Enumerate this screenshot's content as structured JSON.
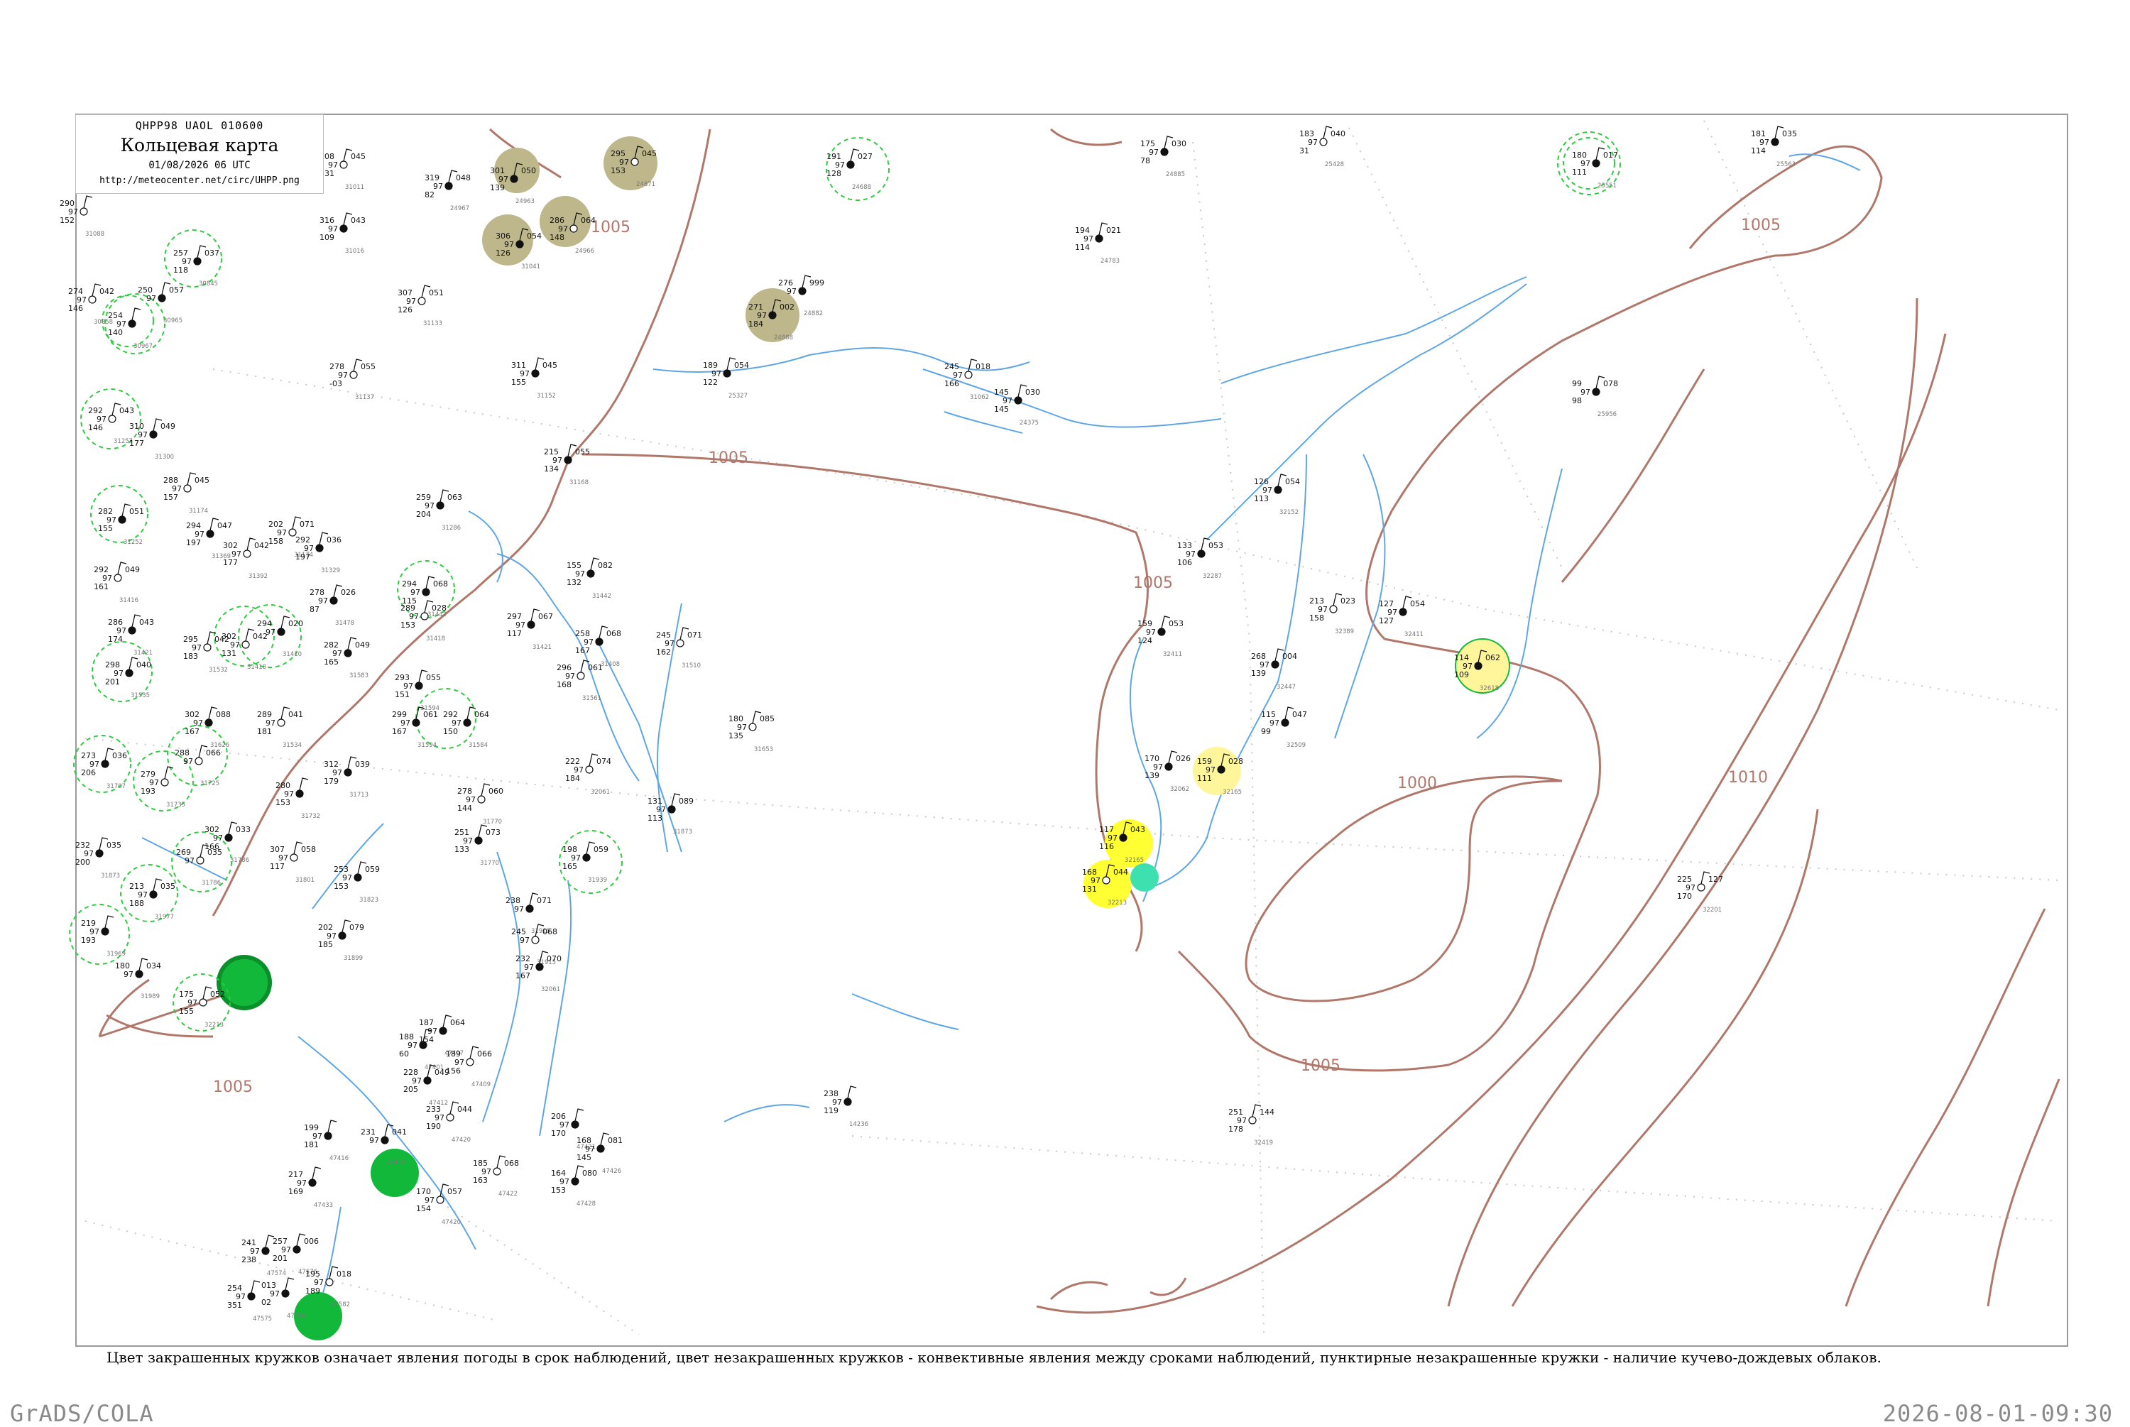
{
  "header": {
    "code": "QHPP98  UAOL  010600",
    "title": "Кольцевая карта",
    "datetime": "01/08/2026 06 UTC",
    "url": "http://meteocenter.net/circ/UHPP.png"
  },
  "isobars": [
    {
      "label": "1005"
    },
    {
      "label": "1005"
    },
    {
      "label": "1005"
    },
    {
      "label": "1005"
    },
    {
      "label": "1005"
    },
    {
      "label": "1005"
    },
    {
      "label": "1000"
    },
    {
      "label": "1010"
    }
  ],
  "stations": [
    {
      "t": "308",
      "dp": "131",
      "p": "045",
      "id": "31011"
    },
    {
      "t": "319",
      "dp": "82",
      "p": "048",
      "id": "24967"
    },
    {
      "t": "301",
      "dp": "139",
      "p": "050",
      "id": "24963"
    },
    {
      "t": "295",
      "dp": "153",
      "p": "045",
      "id": "24871"
    },
    {
      "t": "191",
      "dp": "128",
      "p": "027",
      "id": "24688"
    },
    {
      "t": "175",
      "dp": "78",
      "p": "030",
      "id": "24885"
    },
    {
      "t": "183",
      "dp": "31",
      "p": "040",
      "id": "25428"
    },
    {
      "t": "180",
      "dp": "111",
      "p": "017",
      "id": "25551"
    },
    {
      "t": "181",
      "dp": "114",
      "p": "035",
      "id": "25563"
    },
    {
      "t": "290",
      "dp": "152",
      "p": "",
      "id": "31088"
    },
    {
      "t": "316",
      "dp": "109",
      "p": "043",
      "id": "31016"
    },
    {
      "t": "306",
      "dp": "126",
      "p": "054",
      "id": "31041"
    },
    {
      "t": "286",
      "dp": "148",
      "p": "064",
      "id": "24966"
    },
    {
      "t": "194",
      "dp": "114",
      "p": "021",
      "id": "24783"
    },
    {
      "t": "257",
      "dp": "118",
      "p": "037",
      "id": "30845"
    },
    {
      "t": "274",
      "dp": "146",
      "p": "042",
      "id": "30858"
    },
    {
      "t": "250",
      "dp": "",
      "p": "057",
      "id": "30965"
    },
    {
      "t": "254",
      "dp": "140",
      "p": "",
      "id": "30967"
    },
    {
      "t": "307",
      "dp": "126",
      "p": "051",
      "id": "31133"
    },
    {
      "t": "276",
      "dp": "",
      "p": "999",
      "id": "24882"
    },
    {
      "t": "271",
      "dp": "184",
      "p": "002",
      "id": "24888"
    },
    {
      "t": "278",
      "dp": "-03",
      "p": "055",
      "id": "31137"
    },
    {
      "t": "311",
      "dp": "155",
      "p": "045",
      "id": "31152"
    },
    {
      "t": "189",
      "dp": "122",
      "p": "054",
      "id": "25327"
    },
    {
      "t": "245",
      "dp": "166",
      "p": "018",
      "id": "31062"
    },
    {
      "t": "145",
      "dp": "145",
      "p": "030",
      "id": "24375"
    },
    {
      "t": "99",
      "dp": "98",
      "p": "078",
      "id": "25956"
    },
    {
      "t": "292",
      "dp": "146",
      "p": "043",
      "id": "31257"
    },
    {
      "t": "310",
      "dp": "177",
      "p": "049",
      "id": "31300"
    },
    {
      "t": "215",
      "dp": "134",
      "p": "055",
      "id": "31168"
    },
    {
      "t": "288",
      "dp": "157",
      "p": "045",
      "id": "31174"
    },
    {
      "t": "282",
      "dp": "155",
      "p": "051",
      "id": "31252"
    },
    {
      "t": "259",
      "dp": "204",
      "p": "063",
      "id": "31286"
    },
    {
      "t": "202",
      "dp": "158",
      "p": "071",
      "id": "31174"
    },
    {
      "t": "126",
      "dp": "113",
      "p": "054",
      "id": "32152"
    },
    {
      "t": "294",
      "dp": "197",
      "p": "047",
      "id": "31369"
    },
    {
      "t": "302",
      "dp": "177",
      "p": "042",
      "id": "31392"
    },
    {
      "t": "292",
      "dp": "197",
      "p": "036",
      "id": "31329"
    },
    {
      "t": "133",
      "dp": "106",
      "p": "053",
      "id": "32287"
    },
    {
      "t": "292",
      "dp": "161",
      "p": "049",
      "id": "31416"
    },
    {
      "t": "294",
      "dp": "115",
      "p": "068",
      "id": "31442"
    },
    {
      "t": "155",
      "dp": "132",
      "p": "082",
      "id": "31442"
    },
    {
      "t": "213",
      "dp": "158",
      "p": "023",
      "id": "32389"
    },
    {
      "t": "127",
      "dp": "127",
      "p": "054",
      "id": "32411"
    },
    {
      "t": "286",
      "dp": "174",
      "p": "043",
      "id": "31421"
    },
    {
      "t": "302",
      "dp": "131",
      "p": "042",
      "id": "31418"
    },
    {
      "t": "294",
      "dp": "",
      "p": "020",
      "id": "31410"
    },
    {
      "t": "278",
      "dp": "87",
      "p": "026",
      "id": "31478"
    },
    {
      "t": "289",
      "dp": "153",
      "p": "028",
      "id": "31418"
    },
    {
      "t": "297",
      "dp": "117",
      "p": "067",
      "id": "31421"
    },
    {
      "t": "258",
      "dp": "167",
      "p": "068",
      "id": "31408"
    },
    {
      "t": "245",
      "dp": "162",
      "p": "071",
      "id": "31510"
    },
    {
      "t": "159",
      "dp": "124",
      "p": "053",
      "id": "32411"
    },
    {
      "t": "298",
      "dp": "201",
      "p": "040",
      "id": "31535"
    },
    {
      "t": "295",
      "dp": "183",
      "p": "042",
      "id": "31532"
    },
    {
      "t": "282",
      "dp": "165",
      "p": "049",
      "id": "31583"
    },
    {
      "t": "293",
      "dp": "151",
      "p": "055",
      "id": "31594"
    },
    {
      "t": "296",
      "dp": "168",
      "p": "061",
      "id": "31561"
    },
    {
      "t": "268",
      "dp": "139",
      "p": "004",
      "id": "32447"
    },
    {
      "t": "114",
      "dp": "109",
      "p": "062",
      "id": "32618"
    },
    {
      "t": "289",
      "dp": "181",
      "p": "041",
      "id": "31534"
    },
    {
      "t": "299",
      "dp": "167",
      "p": "061",
      "id": "31594"
    },
    {
      "t": "292",
      "dp": "150",
      "p": "064",
      "id": "31584"
    },
    {
      "t": "180",
      "dp": "135",
      "p": "085",
      "id": "31653"
    },
    {
      "t": "115",
      "dp": "99",
      "p": "047",
      "id": "32509"
    },
    {
      "t": "273",
      "dp": "206",
      "p": "036",
      "id": "31707"
    },
    {
      "t": "288",
      "dp": "",
      "p": "066",
      "id": "31725"
    },
    {
      "t": "302",
      "dp": "167",
      "p": "088",
      "id": "31626"
    },
    {
      "t": "312",
      "dp": "179",
      "p": "039",
      "id": "31713"
    },
    {
      "t": "222",
      "dp": "184",
      "p": "074",
      "id": "32061"
    },
    {
      "t": "170",
      "dp": "139",
      "p": "026",
      "id": "32062"
    },
    {
      "t": "159",
      "dp": "111",
      "p": "028",
      "id": "32165"
    },
    {
      "t": "279",
      "dp": "193",
      "p": "",
      "id": "31735"
    },
    {
      "t": "280",
      "dp": "153",
      "p": "",
      "id": "31732"
    },
    {
      "t": "131",
      "dp": "113",
      "p": "089",
      "id": "31873"
    },
    {
      "t": "278",
      "dp": "144",
      "p": "060",
      "id": "31770"
    },
    {
      "t": "232",
      "dp": "200",
      "p": "035",
      "id": "31873"
    },
    {
      "t": "302",
      "dp": "166",
      "p": "033",
      "id": "31786"
    },
    {
      "t": "307",
      "dp": "117",
      "p": "058",
      "id": "31801"
    },
    {
      "t": "251",
      "dp": "133",
      "p": "073",
      "id": "31770"
    },
    {
      "t": "117",
      "dp": "116",
      "p": "043",
      "id": "32165"
    },
    {
      "t": "269",
      "dp": "",
      "p": "035",
      "id": "31786"
    },
    {
      "t": "253",
      "dp": "153",
      "p": "059",
      "id": "31823"
    },
    {
      "t": "198",
      "dp": "165",
      "p": "059",
      "id": "31939"
    },
    {
      "t": "168",
      "dp": "131",
      "p": "044",
      "id": "32213"
    },
    {
      "t": "213",
      "dp": "188",
      "p": "035",
      "id": "31977"
    },
    {
      "t": "238",
      "dp": "",
      "p": "071",
      "id": "31915"
    },
    {
      "t": "225",
      "dp": "170",
      "p": "127",
      "id": "32201"
    },
    {
      "t": "219",
      "dp": "193",
      "p": "",
      "id": "31969"
    },
    {
      "t": "202",
      "dp": "185",
      "p": "079",
      "id": "31899"
    },
    {
      "t": "245",
      "dp": "",
      "p": "068",
      "id": "31915"
    },
    {
      "t": "180",
      "dp": "",
      "p": "034",
      "id": "31989"
    },
    {
      "t": "232",
      "dp": "167",
      "p": "070",
      "id": "32061"
    },
    {
      "t": "175",
      "dp": "155",
      "p": "052",
      "id": "32213"
    },
    {
      "t": "188",
      "dp": "60",
      "p": "",
      "id": "47401"
    },
    {
      "t": "187",
      "dp": "154",
      "p": "064",
      "id": "47407"
    },
    {
      "t": "189",
      "dp": "156",
      "p": "066",
      "id": "47409"
    },
    {
      "t": "228",
      "dp": "205",
      "p": "049",
      "id": "47412"
    },
    {
      "t": "238",
      "dp": "119",
      "p": "",
      "id": "14236"
    },
    {
      "t": "233",
      "dp": "190",
      "p": "044",
      "id": "47420"
    },
    {
      "t": "206",
      "dp": "170",
      "p": "",
      "id": "47421"
    },
    {
      "t": "168",
      "dp": "145",
      "p": "081",
      "id": "47426"
    },
    {
      "t": "251",
      "dp": "178",
      "p": "144",
      "id": "32419"
    },
    {
      "t": "199",
      "dp": "181",
      "p": "",
      "id": "47416"
    },
    {
      "t": "231",
      "dp": "",
      "p": "041",
      "id": "47418"
    },
    {
      "t": "185",
      "dp": "163",
      "p": "068",
      "id": "47422"
    },
    {
      "t": "164",
      "dp": "153",
      "p": "080",
      "id": "47428"
    },
    {
      "t": "217",
      "dp": "169",
      "p": "",
      "id": "47433"
    },
    {
      "t": "170",
      "dp": "154",
      "p": "057",
      "id": "47420"
    },
    {
      "t": "241",
      "dp": "238",
      "p": "",
      "id": "47574"
    },
    {
      "t": "257",
      "dp": "201",
      "p": "006",
      "id": "47576"
    },
    {
      "t": "195",
      "dp": "189",
      "p": "018",
      "id": "47582"
    },
    {
      "t": "254",
      "dp": "351",
      "p": "",
      "id": "47575"
    },
    {
      "t": "013",
      "dp": "02",
      "p": "",
      "id": "47584"
    }
  ],
  "caption": "Цвет закрашенных кружков означает явления погоды в срок наблюдений, цвет незакрашенных кружков - конвективные явления между сроками наблюдений, пунктирные незакрашенные кружки - наличие кучево-дождевых облаков.",
  "footer": {
    "credit": "GrADS/COLA",
    "timestamp": "2026-08-01-09:30"
  },
  "colors": {
    "isobar": "#b0776a",
    "river": "#5fa6e6",
    "frame": "#9a9a9a",
    "dashed_circle": "#2ecc40",
    "solid_green": "#12b83a",
    "olive": "#bdb78b",
    "yellow": "#ffff33",
    "pale_yellow": "#fff59a",
    "teal": "#3fe0b0"
  }
}
